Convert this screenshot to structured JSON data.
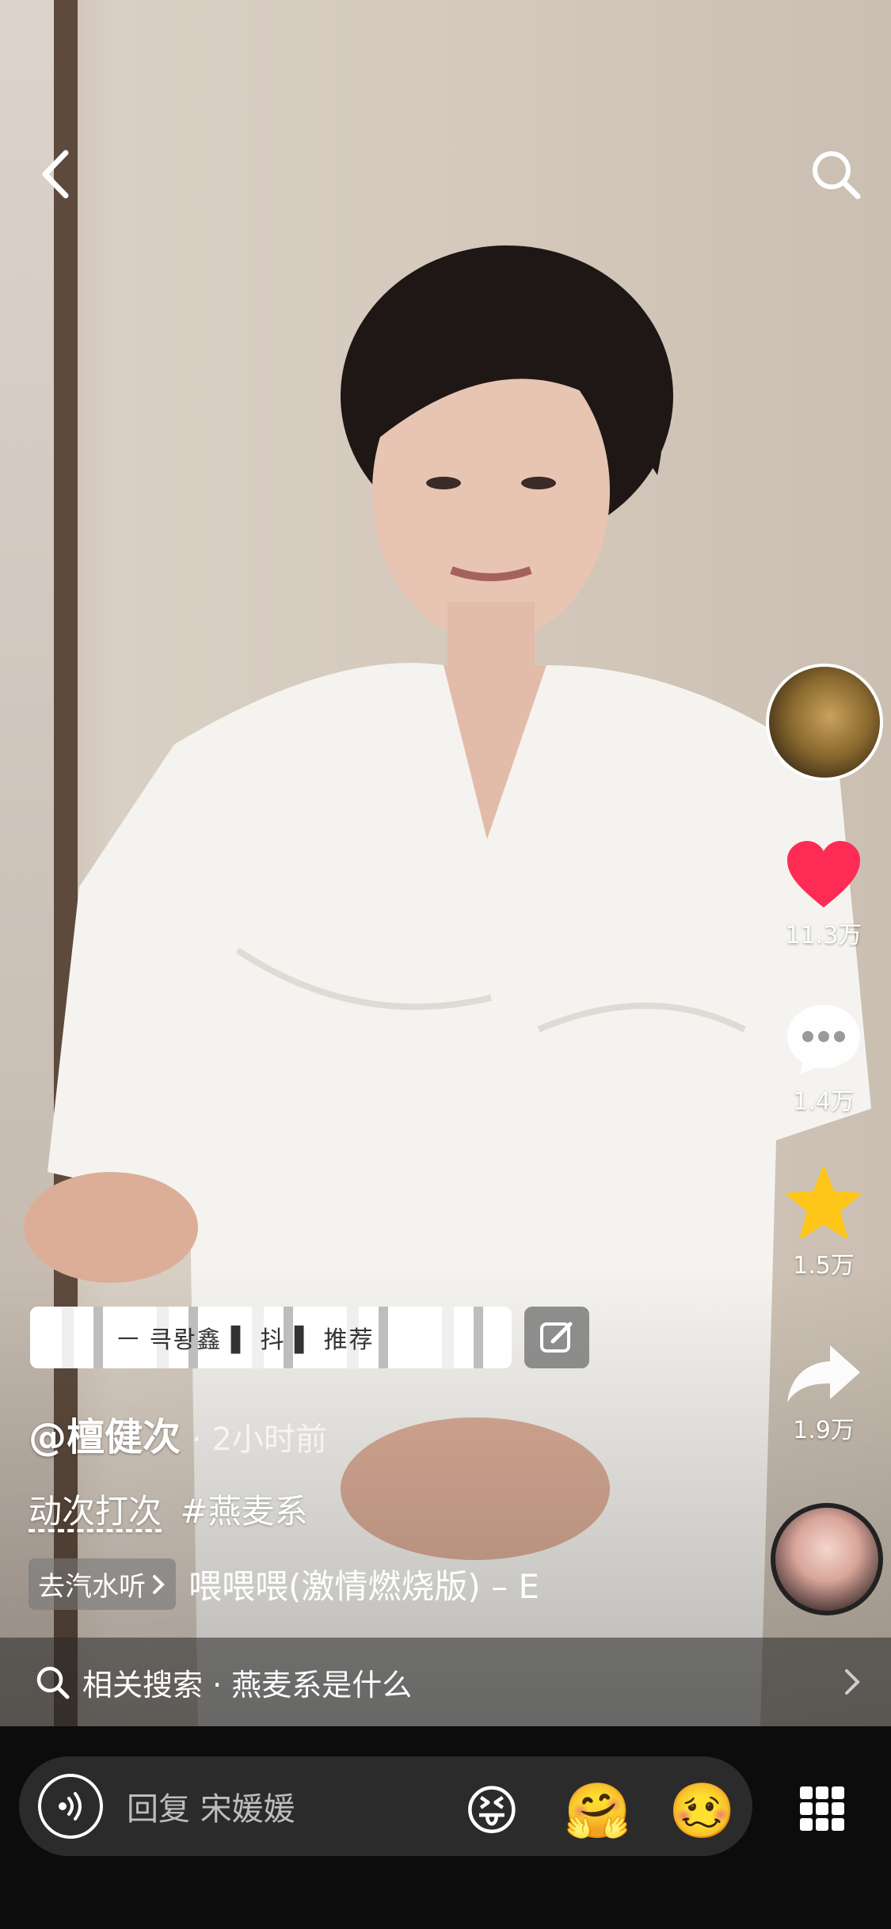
{
  "video": {
    "description_hidden": ""
  },
  "nav": {
    "back_icon": "chevron-left-icon",
    "search_icon": "search-icon"
  },
  "rail": {
    "like_count": "11.3万",
    "comment_count": "1.4万",
    "favorite_count": "1.5万",
    "share_count": "1.9万",
    "like_color": "#fe2c55",
    "favorite_color": "#ffc61a"
  },
  "hot_comment": {
    "text": "ㅡ 큭뢍鑫 ▌ 抖 ▌ 推荐"
  },
  "post": {
    "author": "@檀健次",
    "time": "· 2小时前",
    "desc_word": "动次打次",
    "hashtag": "#燕麦系",
    "music_chip": "去汽水听",
    "music_title": "喂喂喂(激情燃烧版) – E"
  },
  "related": {
    "label": "相关搜索 · 燕麦系是什么"
  },
  "bottom": {
    "reply_placeholder": "回复 宋媛媛",
    "emoji_1": "😝",
    "emoji_2": "🤗",
    "emoji_3": "🥴"
  }
}
